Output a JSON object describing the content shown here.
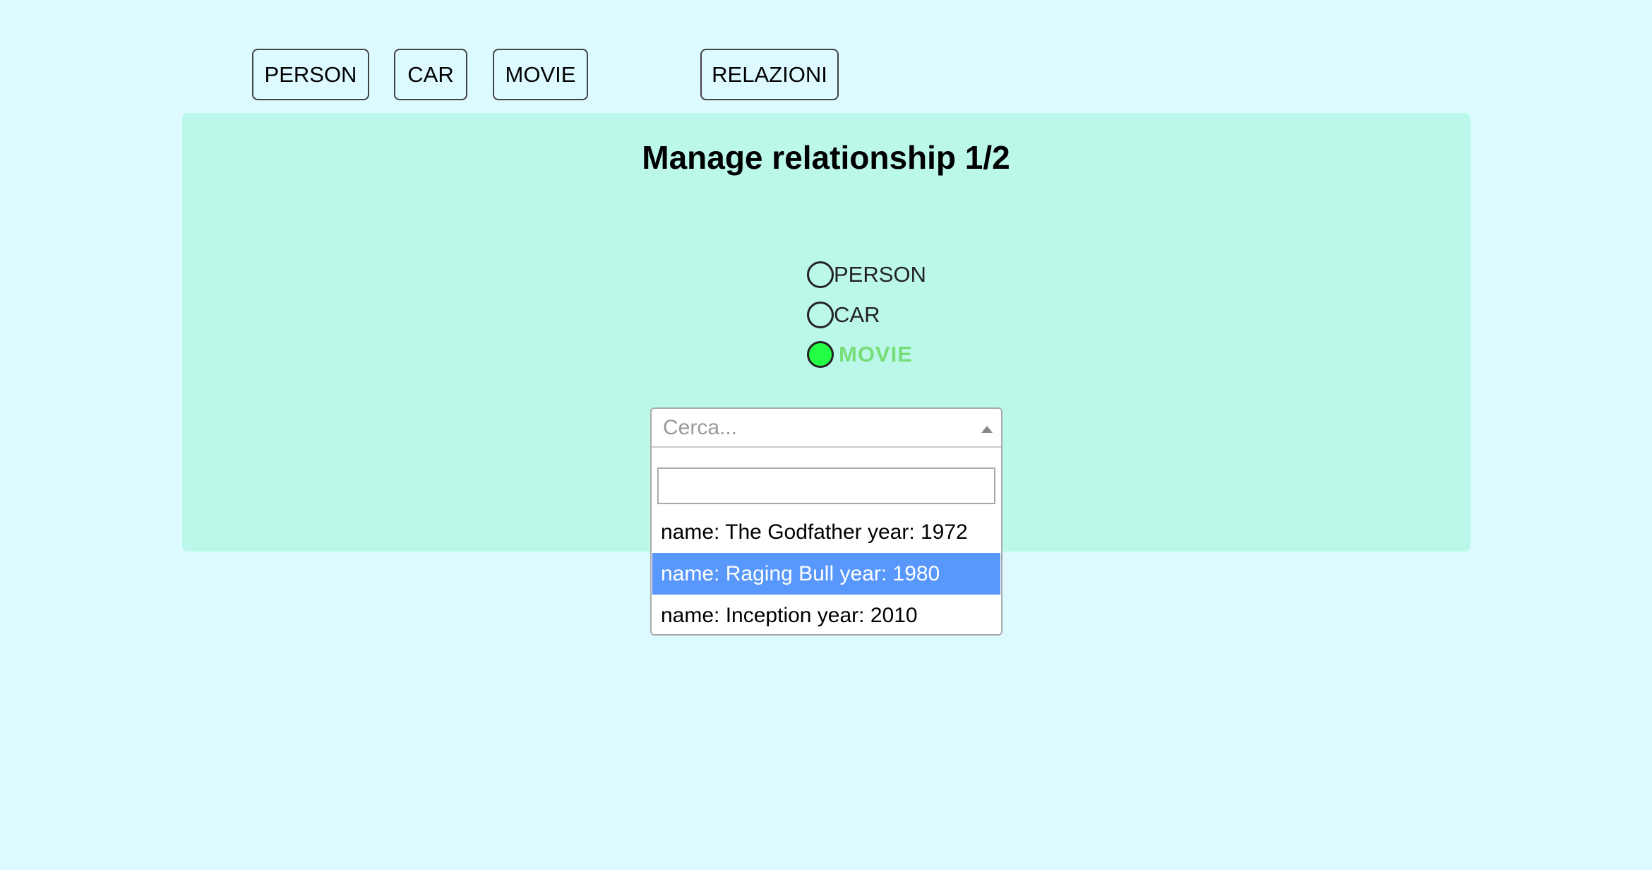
{
  "nav": {
    "buttons": [
      "PERSON",
      "CAR",
      "MOVIE",
      "RELAZIONI"
    ]
  },
  "panel": {
    "title": "Manage relationship 1/2",
    "entity_options": [
      {
        "label": "PERSON",
        "checked": false
      },
      {
        "label": "CAR",
        "checked": false
      },
      {
        "label": "MOVIE",
        "checked": true
      }
    ]
  },
  "select": {
    "placeholder": "Cerca...",
    "search_value": "",
    "options": [
      {
        "label": "name: The Godfather year: 1972",
        "highlighted": false
      },
      {
        "label": "name: Raging Bull year: 1980",
        "highlighted": true
      },
      {
        "label": "name: Inception year: 2010",
        "highlighted": false
      }
    ]
  },
  "colors": {
    "background": "#dcfaff",
    "panel": "#bbf8ea",
    "selected_radio": "#22ff44",
    "selected_label": "#77dd77",
    "highlight": "#5897fb"
  }
}
